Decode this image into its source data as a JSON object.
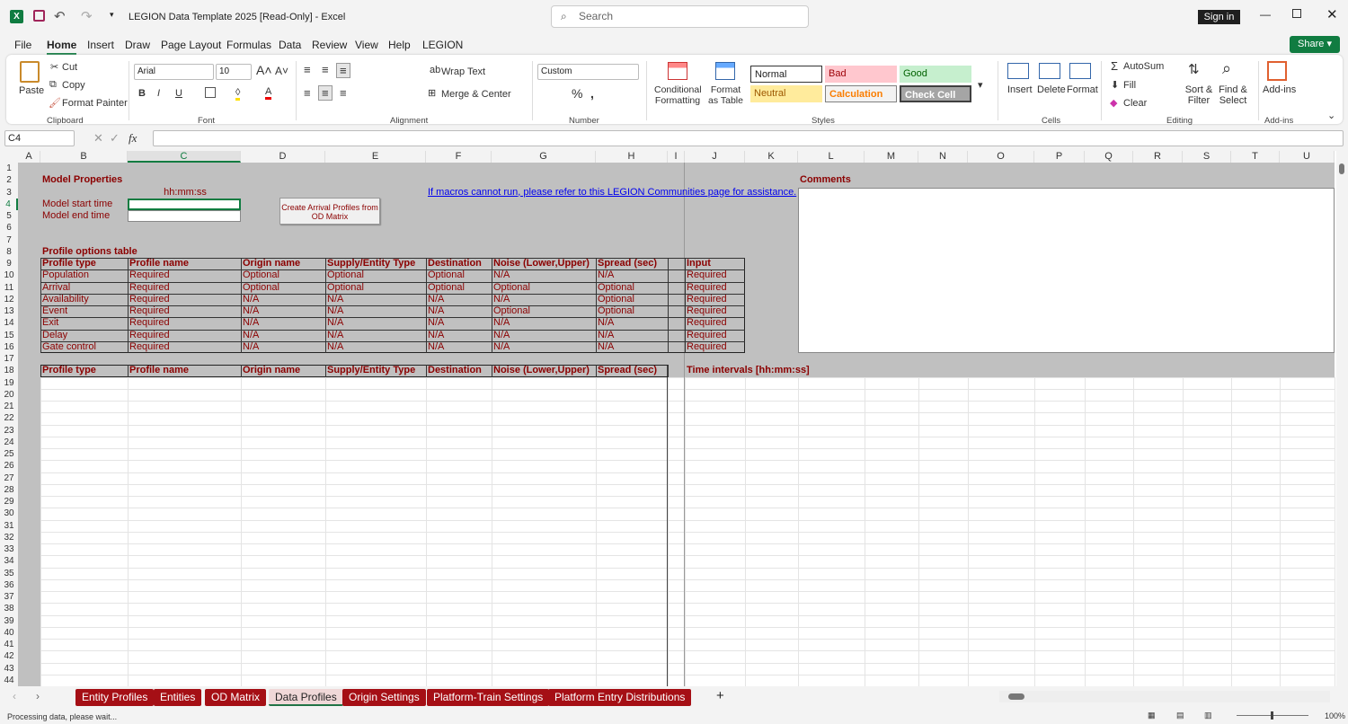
{
  "window": {
    "title": "LEGION Data Template 2025  [Read-Only]  -  Excel",
    "search_placeholder": "Search",
    "sign_in": "Sign in",
    "share": "Share"
  },
  "menu": [
    "File",
    "Home",
    "Insert",
    "Draw",
    "Page Layout",
    "Formulas",
    "Data",
    "Review",
    "View",
    "Help",
    "LEGION"
  ],
  "ribbon": {
    "paste": "Paste",
    "cut": "Cut",
    "copy": "Copy",
    "format_painter": "Format Painter",
    "font": "Arial",
    "font_size": "10",
    "wrap_text": "Wrap Text",
    "merge_center": "Merge & Center",
    "number_format": "Custom",
    "conditional_formatting": "Conditional Formatting",
    "format_as_table": "Format as Table",
    "styles": [
      "Normal",
      "Bad",
      "Good",
      "Neutral",
      "Calculation",
      "Check Cell"
    ],
    "insert": "Insert",
    "delete": "Delete",
    "format": "Format",
    "autosum": "AutoSum",
    "fill": "Fill",
    "clear": "Clear",
    "sort_filter": "Sort & Filter",
    "find_select": "Find & Select",
    "addins": "Add-ins",
    "groups": [
      "Clipboard",
      "Font",
      "Alignment",
      "Number",
      "Styles",
      "Cells",
      "Editing",
      "Add-ins"
    ]
  },
  "formula_bar": {
    "name_box": "C4",
    "formula": ""
  },
  "columns": [
    "A",
    "B",
    "C",
    "D",
    "E",
    "F",
    "G",
    "H",
    "I",
    "J",
    "K",
    "L",
    "M",
    "N",
    "O",
    "P",
    "Q",
    "R",
    "S",
    "T",
    "U"
  ],
  "sheet": {
    "model_properties": "Model Properties",
    "time_format": "hh:mm:ss",
    "start_label": "Model start time",
    "end_label": "Model end time",
    "macro_button": "Create Arrival Profiles from OD Matrix",
    "help_link": "If macros cannot run, please refer to this LEGION Communities page for assistance.",
    "comments": "Comments",
    "profile_options_title": "Profile options table",
    "options_headers": [
      "Profile type",
      "Profile name",
      "Origin name",
      "Supply/Entity Type",
      "Destination",
      "Noise (Lower,Upper)",
      "Spread (sec)",
      "",
      "Input"
    ],
    "options_rows": [
      [
        "Population",
        "Required",
        "Optional",
        "Optional",
        "Optional",
        "N/A",
        "N/A",
        "",
        "Required"
      ],
      [
        "Arrival",
        "Required",
        "Optional",
        "Optional",
        "Optional",
        "Optional",
        "Optional",
        "",
        "Required"
      ],
      [
        "Availability",
        "Required",
        "N/A",
        "N/A",
        "N/A",
        "N/A",
        "Optional",
        "",
        "Required"
      ],
      [
        "Event",
        "Required",
        "N/A",
        "N/A",
        "N/A",
        "Optional",
        "Optional",
        "",
        "Required"
      ],
      [
        "Exit",
        "Required",
        "N/A",
        "N/A",
        "N/A",
        "N/A",
        "N/A",
        "",
        "Required"
      ],
      [
        "Delay",
        "Required",
        "N/A",
        "N/A",
        "N/A",
        "N/A",
        "N/A",
        "",
        "Required"
      ],
      [
        "Gate control",
        "Required",
        "N/A",
        "N/A",
        "N/A",
        "N/A",
        "N/A",
        "",
        "Required"
      ]
    ],
    "data_headers": [
      "Profile type",
      "Profile name",
      "Origin name",
      "Supply/Entity Type",
      "Destination",
      "Noise (Lower,Upper)",
      "Spread (sec)"
    ],
    "time_intervals": "Time intervals [hh:mm:ss]"
  },
  "tabs": [
    {
      "label": "Entity Profiles"
    },
    {
      "label": "Entities"
    },
    {
      "label": "OD Matrix"
    },
    {
      "label": "Data Profiles",
      "active": true
    },
    {
      "label": "Origin Settings"
    },
    {
      "label": "Platform-Train Settings"
    },
    {
      "label": "Platform Entry Distributions"
    }
  ],
  "status": {
    "text": "Processing data, please wait...",
    "zoom": "100%"
  }
}
